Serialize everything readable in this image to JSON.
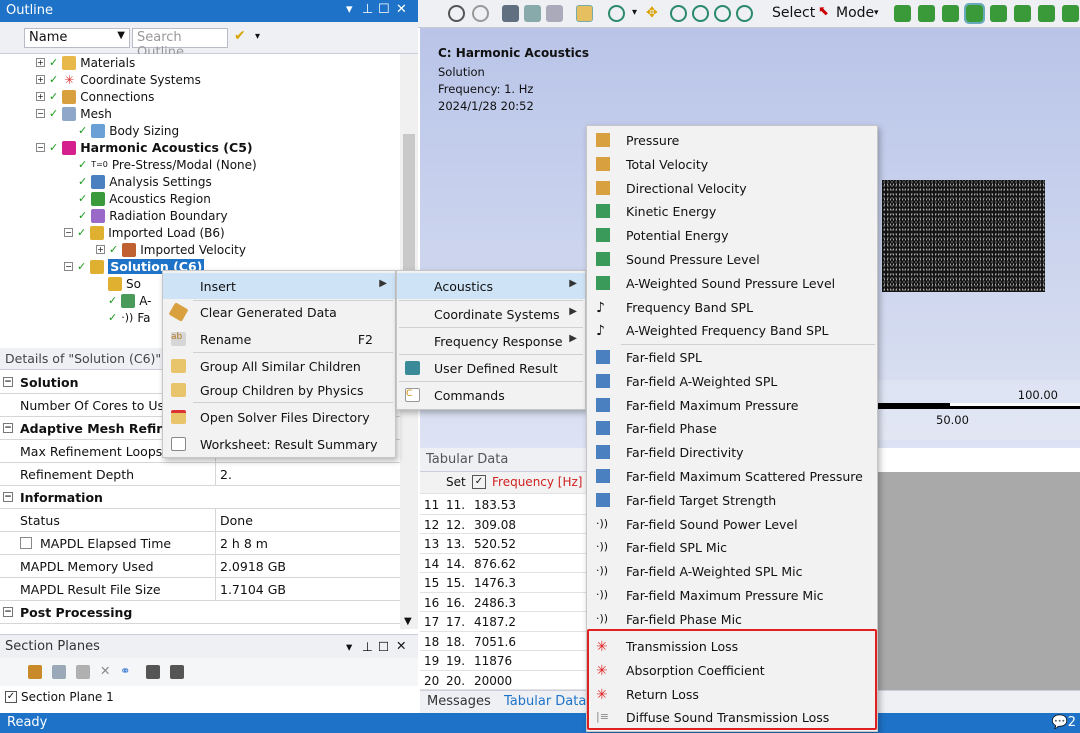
{
  "outline": {
    "title": "Outline",
    "name_combo": "Name",
    "search_placeholder": "Search Outline",
    "tree": [
      {
        "label": "Materials"
      },
      {
        "label": "Coordinate Systems"
      },
      {
        "label": "Connections"
      },
      {
        "label": "Mesh"
      },
      {
        "label": "Body Sizing"
      },
      {
        "label": "Harmonic Acoustics (C5)"
      },
      {
        "label": "Pre-Stress/Modal (None)"
      },
      {
        "label": "Analysis Settings"
      },
      {
        "label": "Acoustics Region"
      },
      {
        "label": "Radiation Boundary"
      },
      {
        "label": "Imported Load (B6)"
      },
      {
        "label": "Imported Velocity"
      },
      {
        "label": "Solution (C6)"
      },
      {
        "label": "So"
      },
      {
        "label": "A-"
      },
      {
        "label": "Fa"
      }
    ]
  },
  "details": {
    "title": "Details of \"Solution (C6)\"",
    "rows": [
      {
        "key": "Solution",
        "value": "",
        "section": true
      },
      {
        "key": "Number Of Cores to Use",
        "value": ""
      },
      {
        "key": "Adaptive Mesh Refineme",
        "value": "",
        "section": true
      },
      {
        "key": "Max Refinement Loops",
        "value": ""
      },
      {
        "key": "Refinement Depth",
        "value": "2."
      },
      {
        "key": "Information",
        "value": "",
        "section": true
      },
      {
        "key": "Status",
        "value": "Done"
      },
      {
        "key": "MAPDL Elapsed Time",
        "value": "2 h 8 m"
      },
      {
        "key": "MAPDL Memory Used",
        "value": "2.0918 GB"
      },
      {
        "key": "MAPDL Result File Size",
        "value": "1.7104 GB"
      },
      {
        "key": "Post Processing",
        "value": "",
        "section": true
      }
    ]
  },
  "section_planes": {
    "title": "Section Planes",
    "item": "Section Plane 1"
  },
  "status_bar": {
    "text": "Ready",
    "count": "2"
  },
  "graphics_toolbar": {
    "select_label": "Select",
    "mode_label": "Mode"
  },
  "viewport": {
    "title": "C: Harmonic Acoustics",
    "subtitle": "Solution",
    "frequency": "Frequency: 1. Hz",
    "timestamp": "2024/1/28 20:52",
    "scale_100": "100.00",
    "scale_50": "50.00"
  },
  "tabular": {
    "title": "Tabular Data",
    "col_set": "Set",
    "col_freq": "Frequency [Hz]",
    "rows": [
      {
        "n": "11",
        "set": "11.",
        "f": "183.53"
      },
      {
        "n": "12",
        "set": "12.",
        "f": "309.08"
      },
      {
        "n": "13",
        "set": "13.",
        "f": "520.52"
      },
      {
        "n": "14",
        "set": "14.",
        "f": "876.62"
      },
      {
        "n": "15",
        "set": "15.",
        "f": "1476.3"
      },
      {
        "n": "16",
        "set": "16.",
        "f": "2486.3"
      },
      {
        "n": "17",
        "set": "17.",
        "f": "4187.2"
      },
      {
        "n": "18",
        "set": "18.",
        "f": "7051.6"
      },
      {
        "n": "19",
        "set": "19.",
        "f": "11876"
      },
      {
        "n": "20",
        "set": "20.",
        "f": "20000"
      }
    ]
  },
  "bottom_tabs": [
    "Messages",
    "Tabular Data"
  ],
  "context_menu": {
    "insert": "Insert",
    "clear": "Clear Generated Data",
    "rename": "Rename",
    "rename_shortcut": "F2",
    "group_similar": "Group All Similar Children",
    "group_physics": "Group Children by Physics",
    "open_dir": "Open Solver Files Directory",
    "worksheet": "Worksheet: Result Summary"
  },
  "insert_menu": {
    "acoustics": "Acoustics",
    "coord": "Coordinate Systems",
    "freq_resp": "Frequency Response",
    "user_defined": "User Defined Result",
    "commands": "Commands"
  },
  "acoustics_menu": [
    "Pressure",
    "Total Velocity",
    "Directional Velocity",
    "Kinetic Energy",
    "Potential Energy",
    "Sound Pressure Level",
    "A-Weighted Sound Pressure Level",
    "Frequency Band SPL",
    "A-Weighted Frequency Band SPL",
    "Far-field SPL",
    "Far-field A-Weighted SPL",
    "Far-field Maximum Pressure",
    "Far-field Phase",
    "Far-field Directivity",
    "Far-field Maximum Scattered Pressure",
    "Far-field Target Strength",
    "Far-field Sound Power Level",
    "Far-field SPL Mic",
    "Far-field A-Weighted SPL Mic",
    "Far-field Maximum Pressure Mic",
    "Far-field Phase Mic",
    "Transmission Loss",
    "Absorption Coefficient",
    "Return Loss",
    "Diffuse Sound Transmission Loss"
  ],
  "colors": {
    "accent": "#1e73c8",
    "highlight_box": "#e02020",
    "check": "#1a9a1a"
  }
}
